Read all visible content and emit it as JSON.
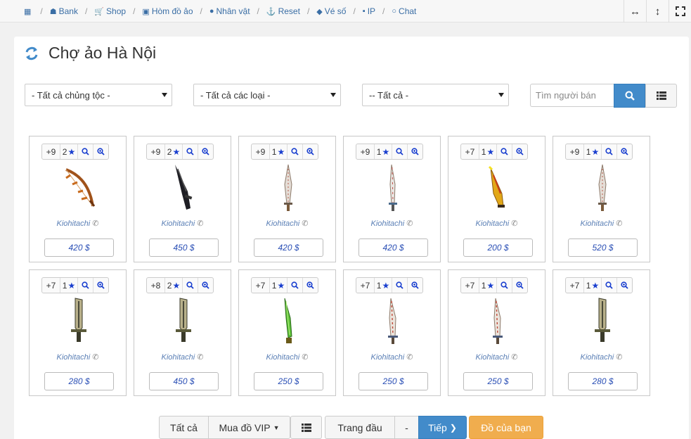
{
  "nav": {
    "items": [
      {
        "label": "",
        "icon": "calendar-icon"
      },
      {
        "label": "Bank",
        "icon": "bank-icon"
      },
      {
        "label": "Shop",
        "icon": "cart-icon"
      },
      {
        "label": "Hòm đồ ảo",
        "icon": "briefcase-icon"
      },
      {
        "label": "Nhân vật",
        "icon": "user-icon"
      },
      {
        "label": "Reset",
        "icon": "anchor-icon"
      },
      {
        "label": "Vé số",
        "icon": "ticket-icon"
      },
      {
        "label": "IP",
        "icon": "lock-icon"
      },
      {
        "label": "Chat",
        "icon": "chat-icon"
      }
    ]
  },
  "page": {
    "title": "Chợ ảo Hà Nội"
  },
  "filters": {
    "race": "- Tất cả chủng tộc -",
    "type": "- Tất cả các loại -",
    "all": "-- Tất cả -",
    "search_placeholder": "Tìm người bán"
  },
  "items": [
    {
      "level": "+9",
      "stars": "2",
      "seller": "Kiohitachi",
      "price": "420 $",
      "kind": "bow"
    },
    {
      "level": "+9",
      "stars": "2",
      "seller": "Kiohitachi",
      "price": "450 $",
      "kind": "dark"
    },
    {
      "level": "+9",
      "stars": "1",
      "seller": "Kiohitachi",
      "price": "420 $",
      "kind": "silver"
    },
    {
      "level": "+9",
      "stars": "1",
      "seller": "Kiohitachi",
      "price": "420 $",
      "kind": "silverthin"
    },
    {
      "level": "+7",
      "stars": "1",
      "seller": "Kiohitachi",
      "price": "200 $",
      "kind": "gold"
    },
    {
      "level": "+9",
      "stars": "1",
      "seller": "Kiohitachi",
      "price": "520 $",
      "kind": "silver"
    },
    {
      "level": "+7",
      "stars": "1",
      "seller": "Kiohitachi",
      "price": "280 $",
      "kind": "broad"
    },
    {
      "level": "+8",
      "stars": "2",
      "seller": "Kiohitachi",
      "price": "450 $",
      "kind": "broad"
    },
    {
      "level": "+7",
      "stars": "1",
      "seller": "Kiohitachi",
      "price": "250 $",
      "kind": "green"
    },
    {
      "level": "+7",
      "stars": "1",
      "seller": "Kiohitachi",
      "price": "250 $",
      "kind": "redsilver"
    },
    {
      "level": "+7",
      "stars": "1",
      "seller": "Kiohitachi",
      "price": "250 $",
      "kind": "redsilver"
    },
    {
      "level": "+7",
      "stars": "1",
      "seller": "Kiohitachi",
      "price": "280 $",
      "kind": "broad"
    }
  ],
  "pager": {
    "all": "Tất cả",
    "vip": "Mua đồ VIP",
    "first": "Trang đầu",
    "dash": "-",
    "next": "Tiếp",
    "mine": "Đồ của bạn"
  },
  "colors": {
    "primary": "#428bca",
    "warning": "#f0ad4e",
    "link": "#3a6ea5"
  }
}
